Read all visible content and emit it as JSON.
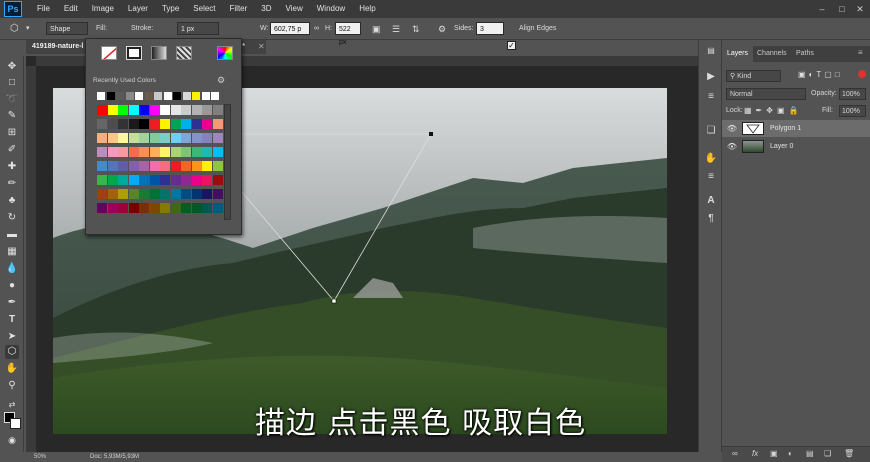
{
  "app": {
    "logo": "Ps"
  },
  "menu": [
    "File",
    "Edit",
    "Image",
    "Layer",
    "Type",
    "Select",
    "Filter",
    "3D",
    "View",
    "Window",
    "Help"
  ],
  "options_bar": {
    "shape_mode": "Shape",
    "fill_label": "Fill:",
    "stroke_label": "Stroke:",
    "stroke_width": "1 px",
    "w_label": "W:",
    "w_value": "602,75 p",
    "h_label": "H:",
    "h_value": "522 px",
    "sides_label": "Sides:",
    "sides_value": "3",
    "align_edges_label": "Align Edges"
  },
  "document": {
    "tab_title": "419189-nature-l",
    "tab_suffix": ") *",
    "zoom": "50%",
    "doc_info": "Doc: 5,93M/5,93M"
  },
  "fill_popup": {
    "recent_label": "Recently Used Colors",
    "recent_colors": [
      "#ffffff",
      "#000000",
      "#5a5a5a",
      "#8a8a8a",
      "#ffffff",
      "#6b5a48",
      "#c8c8c8",
      "#ffffff",
      "#000000",
      "#d8d8d8",
      "#fff200",
      "#ffffff",
      "#ffffff"
    ]
  },
  "subtitle": "描边 点击黑色 吸取白色",
  "layers_panel": {
    "tabs": [
      "Layers",
      "Channels",
      "Paths"
    ],
    "filter": "Kind",
    "blend_mode": "Normal",
    "opacity_label": "Opacity:",
    "opacity_value": "100%",
    "lock_label": "Lock:",
    "fill_label": "Fill:",
    "fill_value": "100%",
    "layers": [
      {
        "name": "Polygon 1"
      },
      {
        "name": "Layer 0"
      }
    ]
  },
  "icons": {
    "tools": [
      "move-icon",
      "marquee-icon",
      "lasso-icon",
      "quick-select-icon",
      "crop-icon",
      "eyedropper-icon",
      "healing-icon",
      "brush-icon",
      "stamp-icon",
      "history-brush-icon",
      "eraser-icon",
      "gradient-icon",
      "blur-icon",
      "dodge-icon",
      "pen-icon",
      "type-icon",
      "path-select-icon",
      "shape-icon",
      "hand-icon",
      "zoom-icon"
    ]
  }
}
